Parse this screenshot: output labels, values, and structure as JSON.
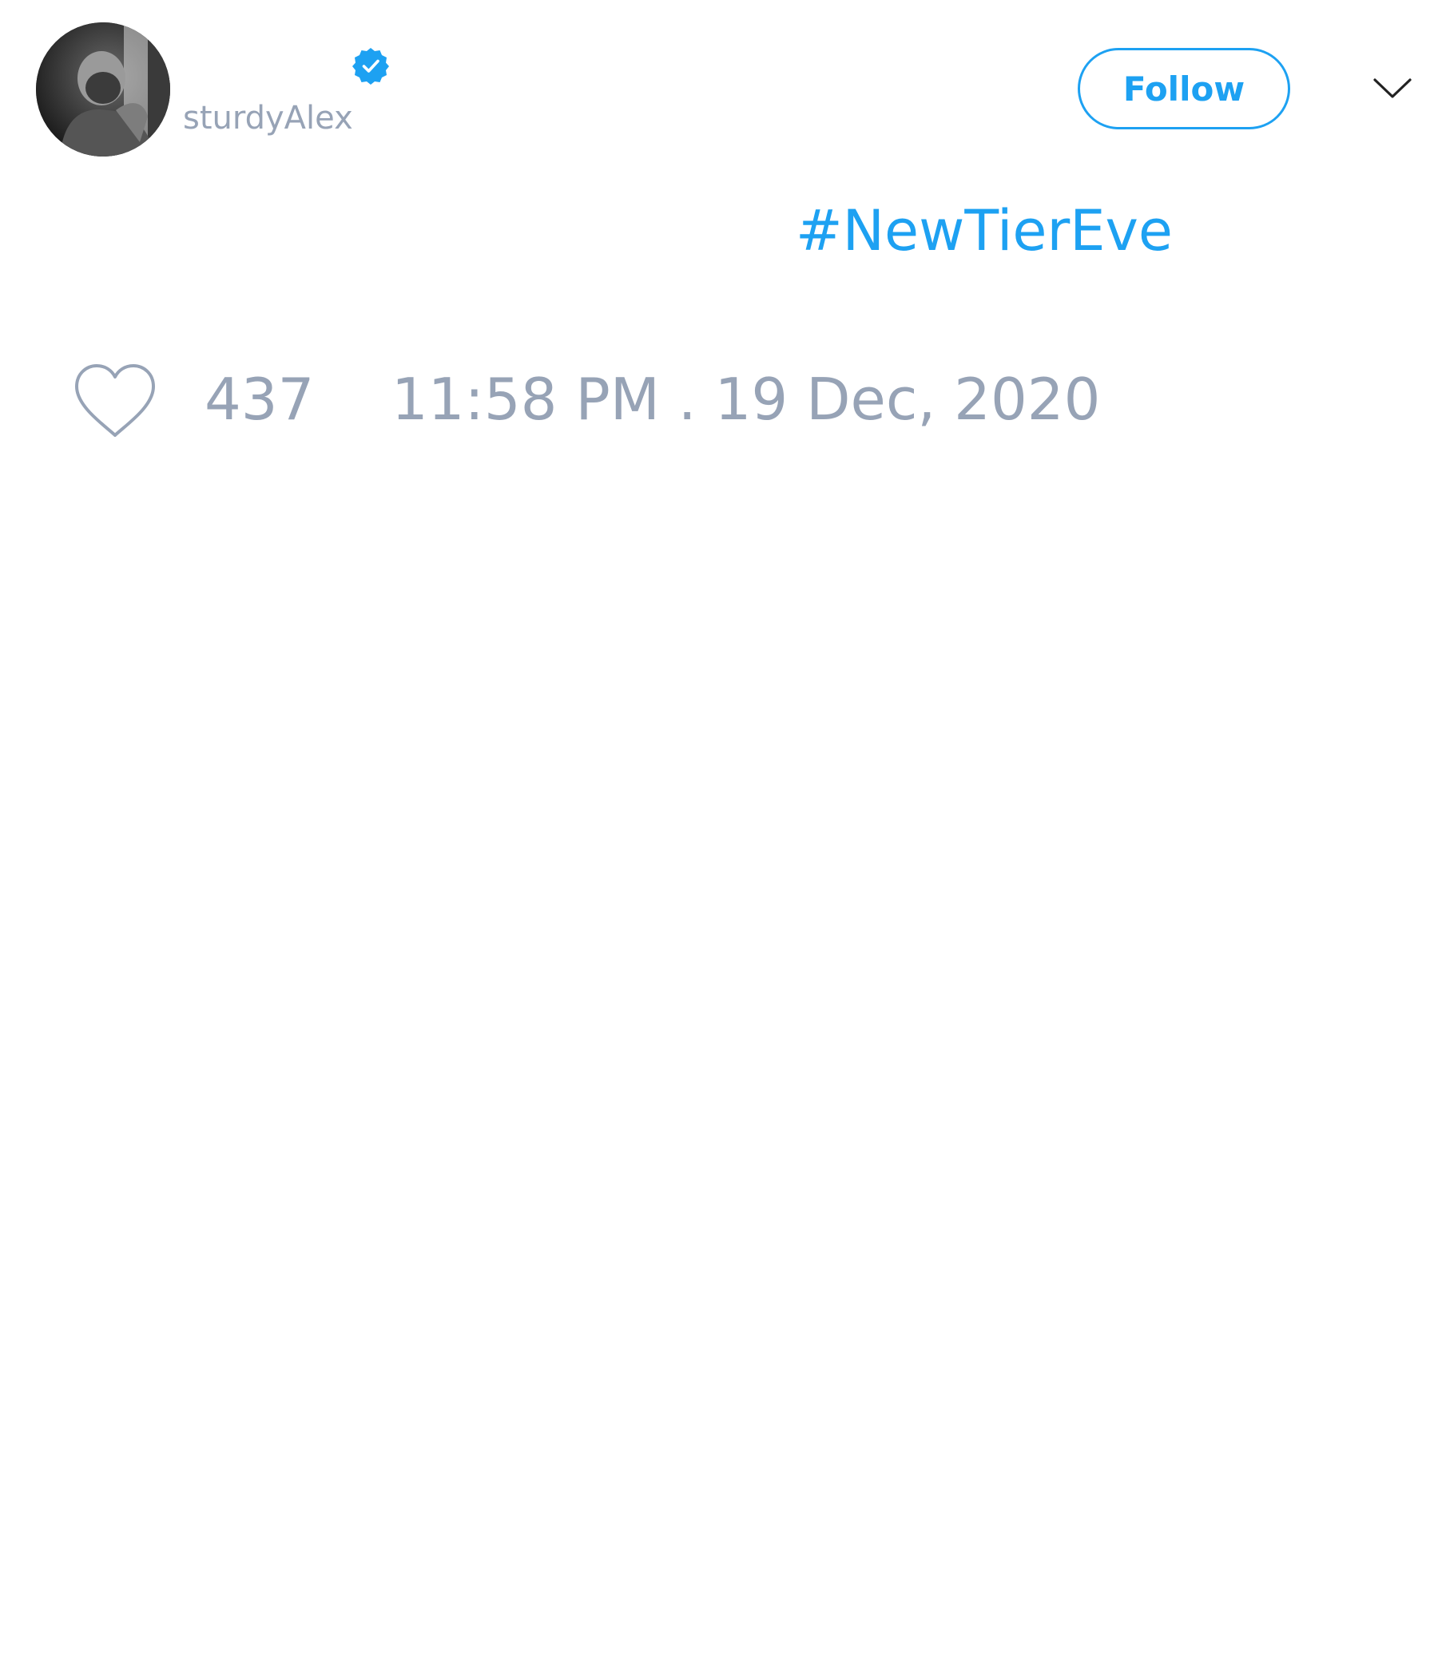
{
  "tweet": {
    "author": {
      "display_name": "",
      "username": "sturdyAlex",
      "verified": true,
      "avatar": "avatar-photo"
    },
    "follow_label": "Follow",
    "more_icon": "chevron-down-icon",
    "body_text": "#NewTierEve",
    "like_icon": "heart-icon",
    "like_count": "437",
    "timestamp": "11:58 PM . 19 Dec, 2020"
  },
  "colors": {
    "accent": "#1da1f2",
    "muted_text": "#97a3b6",
    "background": "#ffffff"
  }
}
